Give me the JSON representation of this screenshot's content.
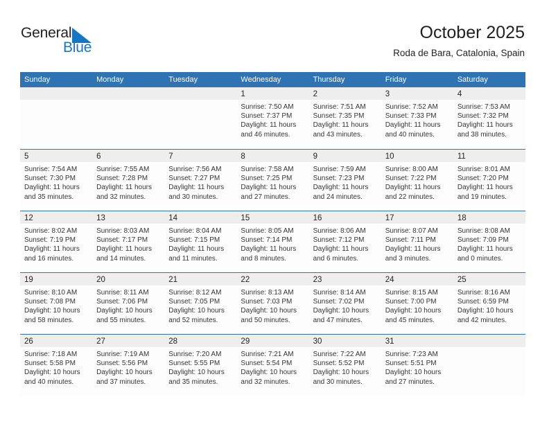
{
  "branding": {
    "logo_text_1": "General",
    "logo_text_2": "Blue",
    "triangle_icon": "triangle-icon",
    "brand_color": "#1577c4"
  },
  "header": {
    "title": "October 2025",
    "subtitle": "Roda de Bara, Catalonia, Spain"
  },
  "colors": {
    "header_blue": "#2e74b5",
    "day_band_gray": "#eeeeee",
    "text": "#231f20"
  },
  "weekdays": [
    "Sunday",
    "Monday",
    "Tuesday",
    "Wednesday",
    "Thursday",
    "Friday",
    "Saturday"
  ],
  "weeks": [
    [
      {
        "day": "",
        "empty": true,
        "sunrise": "",
        "sunset": "",
        "daylight_1": "",
        "daylight_2": ""
      },
      {
        "day": "",
        "empty": true,
        "sunrise": "",
        "sunset": "",
        "daylight_1": "",
        "daylight_2": ""
      },
      {
        "day": "",
        "empty": true,
        "sunrise": "",
        "sunset": "",
        "daylight_1": "",
        "daylight_2": ""
      },
      {
        "day": "1",
        "empty": false,
        "sunrise": "Sunrise: 7:50 AM",
        "sunset": "Sunset: 7:37 PM",
        "daylight_1": "Daylight: 11 hours",
        "daylight_2": "and 46 minutes."
      },
      {
        "day": "2",
        "empty": false,
        "sunrise": "Sunrise: 7:51 AM",
        "sunset": "Sunset: 7:35 PM",
        "daylight_1": "Daylight: 11 hours",
        "daylight_2": "and 43 minutes."
      },
      {
        "day": "3",
        "empty": false,
        "sunrise": "Sunrise: 7:52 AM",
        "sunset": "Sunset: 7:33 PM",
        "daylight_1": "Daylight: 11 hours",
        "daylight_2": "and 40 minutes."
      },
      {
        "day": "4",
        "empty": false,
        "sunrise": "Sunrise: 7:53 AM",
        "sunset": "Sunset: 7:32 PM",
        "daylight_1": "Daylight: 11 hours",
        "daylight_2": "and 38 minutes."
      }
    ],
    [
      {
        "day": "5",
        "empty": false,
        "sunrise": "Sunrise: 7:54 AM",
        "sunset": "Sunset: 7:30 PM",
        "daylight_1": "Daylight: 11 hours",
        "daylight_2": "and 35 minutes."
      },
      {
        "day": "6",
        "empty": false,
        "sunrise": "Sunrise: 7:55 AM",
        "sunset": "Sunset: 7:28 PM",
        "daylight_1": "Daylight: 11 hours",
        "daylight_2": "and 32 minutes."
      },
      {
        "day": "7",
        "empty": false,
        "sunrise": "Sunrise: 7:56 AM",
        "sunset": "Sunset: 7:27 PM",
        "daylight_1": "Daylight: 11 hours",
        "daylight_2": "and 30 minutes."
      },
      {
        "day": "8",
        "empty": false,
        "sunrise": "Sunrise: 7:58 AM",
        "sunset": "Sunset: 7:25 PM",
        "daylight_1": "Daylight: 11 hours",
        "daylight_2": "and 27 minutes."
      },
      {
        "day": "9",
        "empty": false,
        "sunrise": "Sunrise: 7:59 AM",
        "sunset": "Sunset: 7:23 PM",
        "daylight_1": "Daylight: 11 hours",
        "daylight_2": "and 24 minutes."
      },
      {
        "day": "10",
        "empty": false,
        "sunrise": "Sunrise: 8:00 AM",
        "sunset": "Sunset: 7:22 PM",
        "daylight_1": "Daylight: 11 hours",
        "daylight_2": "and 22 minutes."
      },
      {
        "day": "11",
        "empty": false,
        "sunrise": "Sunrise: 8:01 AM",
        "sunset": "Sunset: 7:20 PM",
        "daylight_1": "Daylight: 11 hours",
        "daylight_2": "and 19 minutes."
      }
    ],
    [
      {
        "day": "12",
        "empty": false,
        "sunrise": "Sunrise: 8:02 AM",
        "sunset": "Sunset: 7:19 PM",
        "daylight_1": "Daylight: 11 hours",
        "daylight_2": "and 16 minutes."
      },
      {
        "day": "13",
        "empty": false,
        "sunrise": "Sunrise: 8:03 AM",
        "sunset": "Sunset: 7:17 PM",
        "daylight_1": "Daylight: 11 hours",
        "daylight_2": "and 14 minutes."
      },
      {
        "day": "14",
        "empty": false,
        "sunrise": "Sunrise: 8:04 AM",
        "sunset": "Sunset: 7:15 PM",
        "daylight_1": "Daylight: 11 hours",
        "daylight_2": "and 11 minutes."
      },
      {
        "day": "15",
        "empty": false,
        "sunrise": "Sunrise: 8:05 AM",
        "sunset": "Sunset: 7:14 PM",
        "daylight_1": "Daylight: 11 hours",
        "daylight_2": "and 8 minutes."
      },
      {
        "day": "16",
        "empty": false,
        "sunrise": "Sunrise: 8:06 AM",
        "sunset": "Sunset: 7:12 PM",
        "daylight_1": "Daylight: 11 hours",
        "daylight_2": "and 6 minutes."
      },
      {
        "day": "17",
        "empty": false,
        "sunrise": "Sunrise: 8:07 AM",
        "sunset": "Sunset: 7:11 PM",
        "daylight_1": "Daylight: 11 hours",
        "daylight_2": "and 3 minutes."
      },
      {
        "day": "18",
        "empty": false,
        "sunrise": "Sunrise: 8:08 AM",
        "sunset": "Sunset: 7:09 PM",
        "daylight_1": "Daylight: 11 hours",
        "daylight_2": "and 0 minutes."
      }
    ],
    [
      {
        "day": "19",
        "empty": false,
        "sunrise": "Sunrise: 8:10 AM",
        "sunset": "Sunset: 7:08 PM",
        "daylight_1": "Daylight: 10 hours",
        "daylight_2": "and 58 minutes."
      },
      {
        "day": "20",
        "empty": false,
        "sunrise": "Sunrise: 8:11 AM",
        "sunset": "Sunset: 7:06 PM",
        "daylight_1": "Daylight: 10 hours",
        "daylight_2": "and 55 minutes."
      },
      {
        "day": "21",
        "empty": false,
        "sunrise": "Sunrise: 8:12 AM",
        "sunset": "Sunset: 7:05 PM",
        "daylight_1": "Daylight: 10 hours",
        "daylight_2": "and 52 minutes."
      },
      {
        "day": "22",
        "empty": false,
        "sunrise": "Sunrise: 8:13 AM",
        "sunset": "Sunset: 7:03 PM",
        "daylight_1": "Daylight: 10 hours",
        "daylight_2": "and 50 minutes."
      },
      {
        "day": "23",
        "empty": false,
        "sunrise": "Sunrise: 8:14 AM",
        "sunset": "Sunset: 7:02 PM",
        "daylight_1": "Daylight: 10 hours",
        "daylight_2": "and 47 minutes."
      },
      {
        "day": "24",
        "empty": false,
        "sunrise": "Sunrise: 8:15 AM",
        "sunset": "Sunset: 7:00 PM",
        "daylight_1": "Daylight: 10 hours",
        "daylight_2": "and 45 minutes."
      },
      {
        "day": "25",
        "empty": false,
        "sunrise": "Sunrise: 8:16 AM",
        "sunset": "Sunset: 6:59 PM",
        "daylight_1": "Daylight: 10 hours",
        "daylight_2": "and 42 minutes."
      }
    ],
    [
      {
        "day": "26",
        "empty": false,
        "sunrise": "Sunrise: 7:18 AM",
        "sunset": "Sunset: 5:58 PM",
        "daylight_1": "Daylight: 10 hours",
        "daylight_2": "and 40 minutes."
      },
      {
        "day": "27",
        "empty": false,
        "sunrise": "Sunrise: 7:19 AM",
        "sunset": "Sunset: 5:56 PM",
        "daylight_1": "Daylight: 10 hours",
        "daylight_2": "and 37 minutes."
      },
      {
        "day": "28",
        "empty": false,
        "sunrise": "Sunrise: 7:20 AM",
        "sunset": "Sunset: 5:55 PM",
        "daylight_1": "Daylight: 10 hours",
        "daylight_2": "and 35 minutes."
      },
      {
        "day": "29",
        "empty": false,
        "sunrise": "Sunrise: 7:21 AM",
        "sunset": "Sunset: 5:54 PM",
        "daylight_1": "Daylight: 10 hours",
        "daylight_2": "and 32 minutes."
      },
      {
        "day": "30",
        "empty": false,
        "sunrise": "Sunrise: 7:22 AM",
        "sunset": "Sunset: 5:52 PM",
        "daylight_1": "Daylight: 10 hours",
        "daylight_2": "and 30 minutes."
      },
      {
        "day": "31",
        "empty": false,
        "sunrise": "Sunrise: 7:23 AM",
        "sunset": "Sunset: 5:51 PM",
        "daylight_1": "Daylight: 10 hours",
        "daylight_2": "and 27 minutes."
      },
      {
        "day": "",
        "empty": true,
        "sunrise": "",
        "sunset": "",
        "daylight_1": "",
        "daylight_2": ""
      }
    ]
  ]
}
